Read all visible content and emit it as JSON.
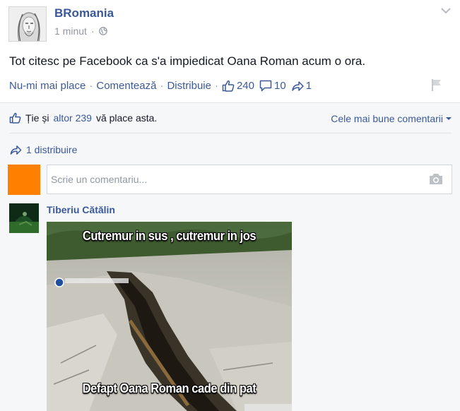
{
  "post": {
    "page_name": "BRomania",
    "time": "1 minut",
    "text": "Tot citesc pe Facebook ca s'a impiedicat Oana Roman acum o ora.",
    "actions": {
      "unlike": "Nu-mi mai place",
      "comment": "Comentează",
      "share": "Distribuie",
      "like_count": "240",
      "comment_count": "10",
      "share_count": "1"
    }
  },
  "feedback": {
    "likes_prefix": "Ție și",
    "likes_link": "altor 239",
    "likes_suffix": "vă place asta.",
    "sort_label": "Cele mai bune comentarii",
    "shares_label": "1 distribuire",
    "composer_placeholder": "Scrie un comentariu..."
  },
  "comment": {
    "author": "Tiberiu Cătălin",
    "meme_top": "Cutremur in sus , cutremur in jos",
    "meme_bottom": "Defapt Oana  Roman cade din pat"
  },
  "colors": {
    "link": "#3b5998",
    "muted": "#9197a3",
    "feedback_bg": "#f6f7f9",
    "composer_avatar": "#ff8000"
  },
  "icons": [
    "globe-icon",
    "chevron-down-icon",
    "like-icon",
    "comment-icon",
    "share-icon",
    "flag-icon",
    "camera-icon",
    "caret-down-icon"
  ]
}
